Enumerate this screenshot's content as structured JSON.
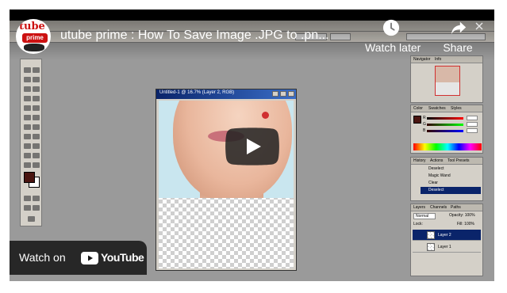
{
  "video": {
    "title": "utube prime : How To Save Image .JPG to .pn..."
  },
  "channel": {
    "logo_top": "tube",
    "logo_mid": "prime"
  },
  "actions": {
    "watch_later": "Watch later",
    "share": "Share"
  },
  "watch_on": {
    "label": "Watch on",
    "brand": "YouTube"
  },
  "photoshop": {
    "document_title": "Untitled-1 @ 16.7% (Layer 2, RGB)",
    "navigator_tabs": [
      "Navigator",
      "Info"
    ],
    "color_tabs": [
      "Color",
      "Swatches",
      "Styles"
    ],
    "history_tabs": [
      "History",
      "Actions",
      "Tool Presets"
    ],
    "history_items": [
      "Deselect",
      "Magic Wand",
      "Clear",
      "Deselect"
    ],
    "layers_tabs": [
      "Layers",
      "Channels",
      "Paths"
    ],
    "blend_mode": "Normal",
    "opacity": "Opacity: 100%",
    "fill": "Fill: 100%",
    "lock_label": "Lock:",
    "layers": [
      "Layer 2",
      "Layer 1"
    ],
    "rgb_values": [
      "R",
      "G",
      "B"
    ]
  },
  "colors": {
    "youtube_red": "#ff0000",
    "play_button_bg": "#212121",
    "watch_on_bg": "#171717"
  }
}
